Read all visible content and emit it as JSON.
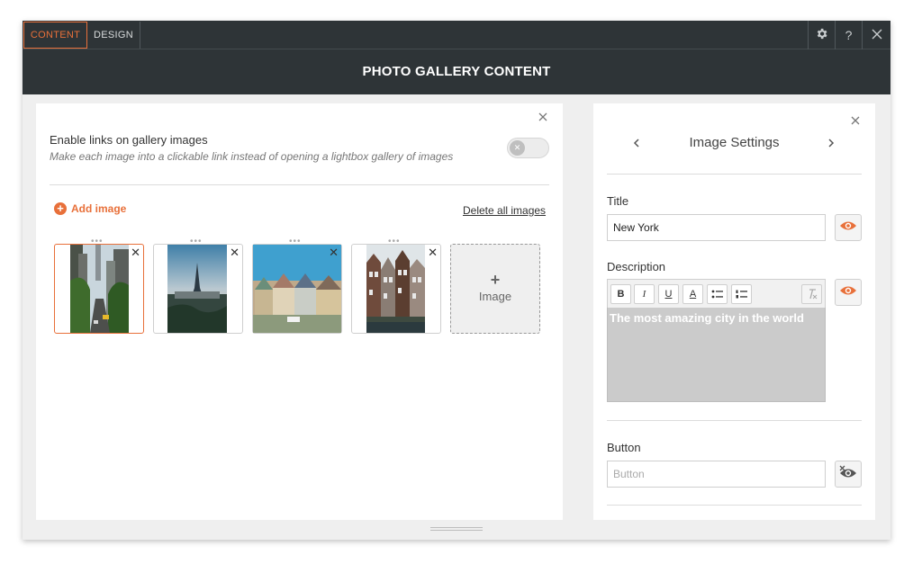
{
  "tabs": {
    "content_label": "CONTENT",
    "design_label": "DESIGN"
  },
  "header": {
    "title": "PHOTO GALLERY CONTENT"
  },
  "toolbar_icons": [
    "gear-icon",
    "help-icon",
    "close-icon"
  ],
  "toolbar_help_glyph": "?",
  "left": {
    "enable_links_title": "Enable links on gallery images",
    "enable_links_subtitle": "Make each image into a clickable link instead of opening a lightbox gallery of images",
    "toggle_on": false,
    "add_image_label": "Add image",
    "delete_all_label": "Delete all images",
    "add_tile_plus": "+",
    "add_tile_label": "Image",
    "thumbnails": [
      {
        "subject": "New York street",
        "selected": true
      },
      {
        "subject": "Paris Eiffel Tower",
        "selected": false
      },
      {
        "subject": "San Francisco painted ladies",
        "selected": false
      },
      {
        "subject": "Amsterdam canal houses",
        "selected": false
      }
    ]
  },
  "right": {
    "settings_title": "Image Settings",
    "title_label": "Title",
    "title_value": "New York",
    "description_label": "Description",
    "description_text": "The most amazing city in the world",
    "button_label": "Button",
    "button_placeholder": "Button",
    "format_buttons": [
      "B",
      "I",
      "U",
      "A"
    ]
  },
  "colors": {
    "accent": "#e8703a",
    "topbar": "#2e3437",
    "canvas": "#efefef"
  }
}
